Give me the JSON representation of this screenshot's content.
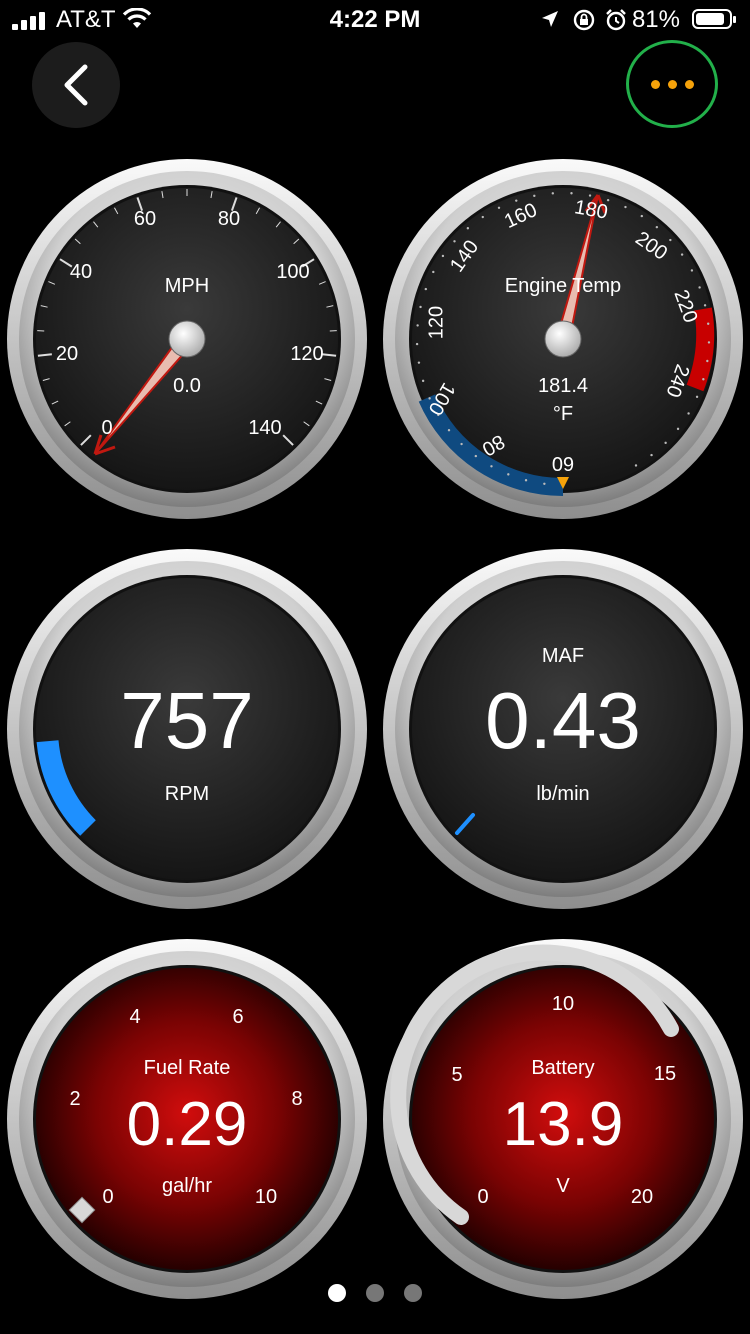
{
  "status": {
    "carrier": "AT&T",
    "time": "4:22 PM",
    "battery_pct": "81%",
    "battery_level": 0.81
  },
  "colors": {
    "accent_more": "#f5a20a",
    "more_ring": "#22b04a",
    "needle": "#d42a1c",
    "rpm_arc": "#1e90ff",
    "cold_zone": "#0f4a80",
    "hot_zone": "#c80000"
  },
  "gauges": {
    "speed": {
      "label": "MPH",
      "value": "0.0",
      "ticks": [
        "0",
        "20",
        "40",
        "60",
        "80",
        "100",
        "120",
        "140"
      ]
    },
    "engine_temp": {
      "label": "Engine Temp",
      "value": "181.4",
      "unit": "°F",
      "ticks": [
        "60",
        "80",
        "100",
        "120",
        "140",
        "160",
        "180",
        "200",
        "220",
        "240"
      ]
    },
    "rpm": {
      "value": "757",
      "unit": "RPM",
      "level": 0.12
    },
    "maf": {
      "label": "MAF",
      "value": "0.43",
      "unit": "lb/min",
      "level": 0.02
    },
    "fuel_rate": {
      "label": "Fuel Rate",
      "value": "0.29",
      "unit": "gal/hr",
      "ticks": [
        "0",
        "2",
        "4",
        "6",
        "8",
        "10"
      ]
    },
    "battery": {
      "label": "Battery",
      "value": "13.9",
      "unit": "V",
      "ticks": [
        "0",
        "5",
        "10",
        "15",
        "20"
      ]
    }
  },
  "pager": {
    "pages": 3,
    "current": 0
  }
}
